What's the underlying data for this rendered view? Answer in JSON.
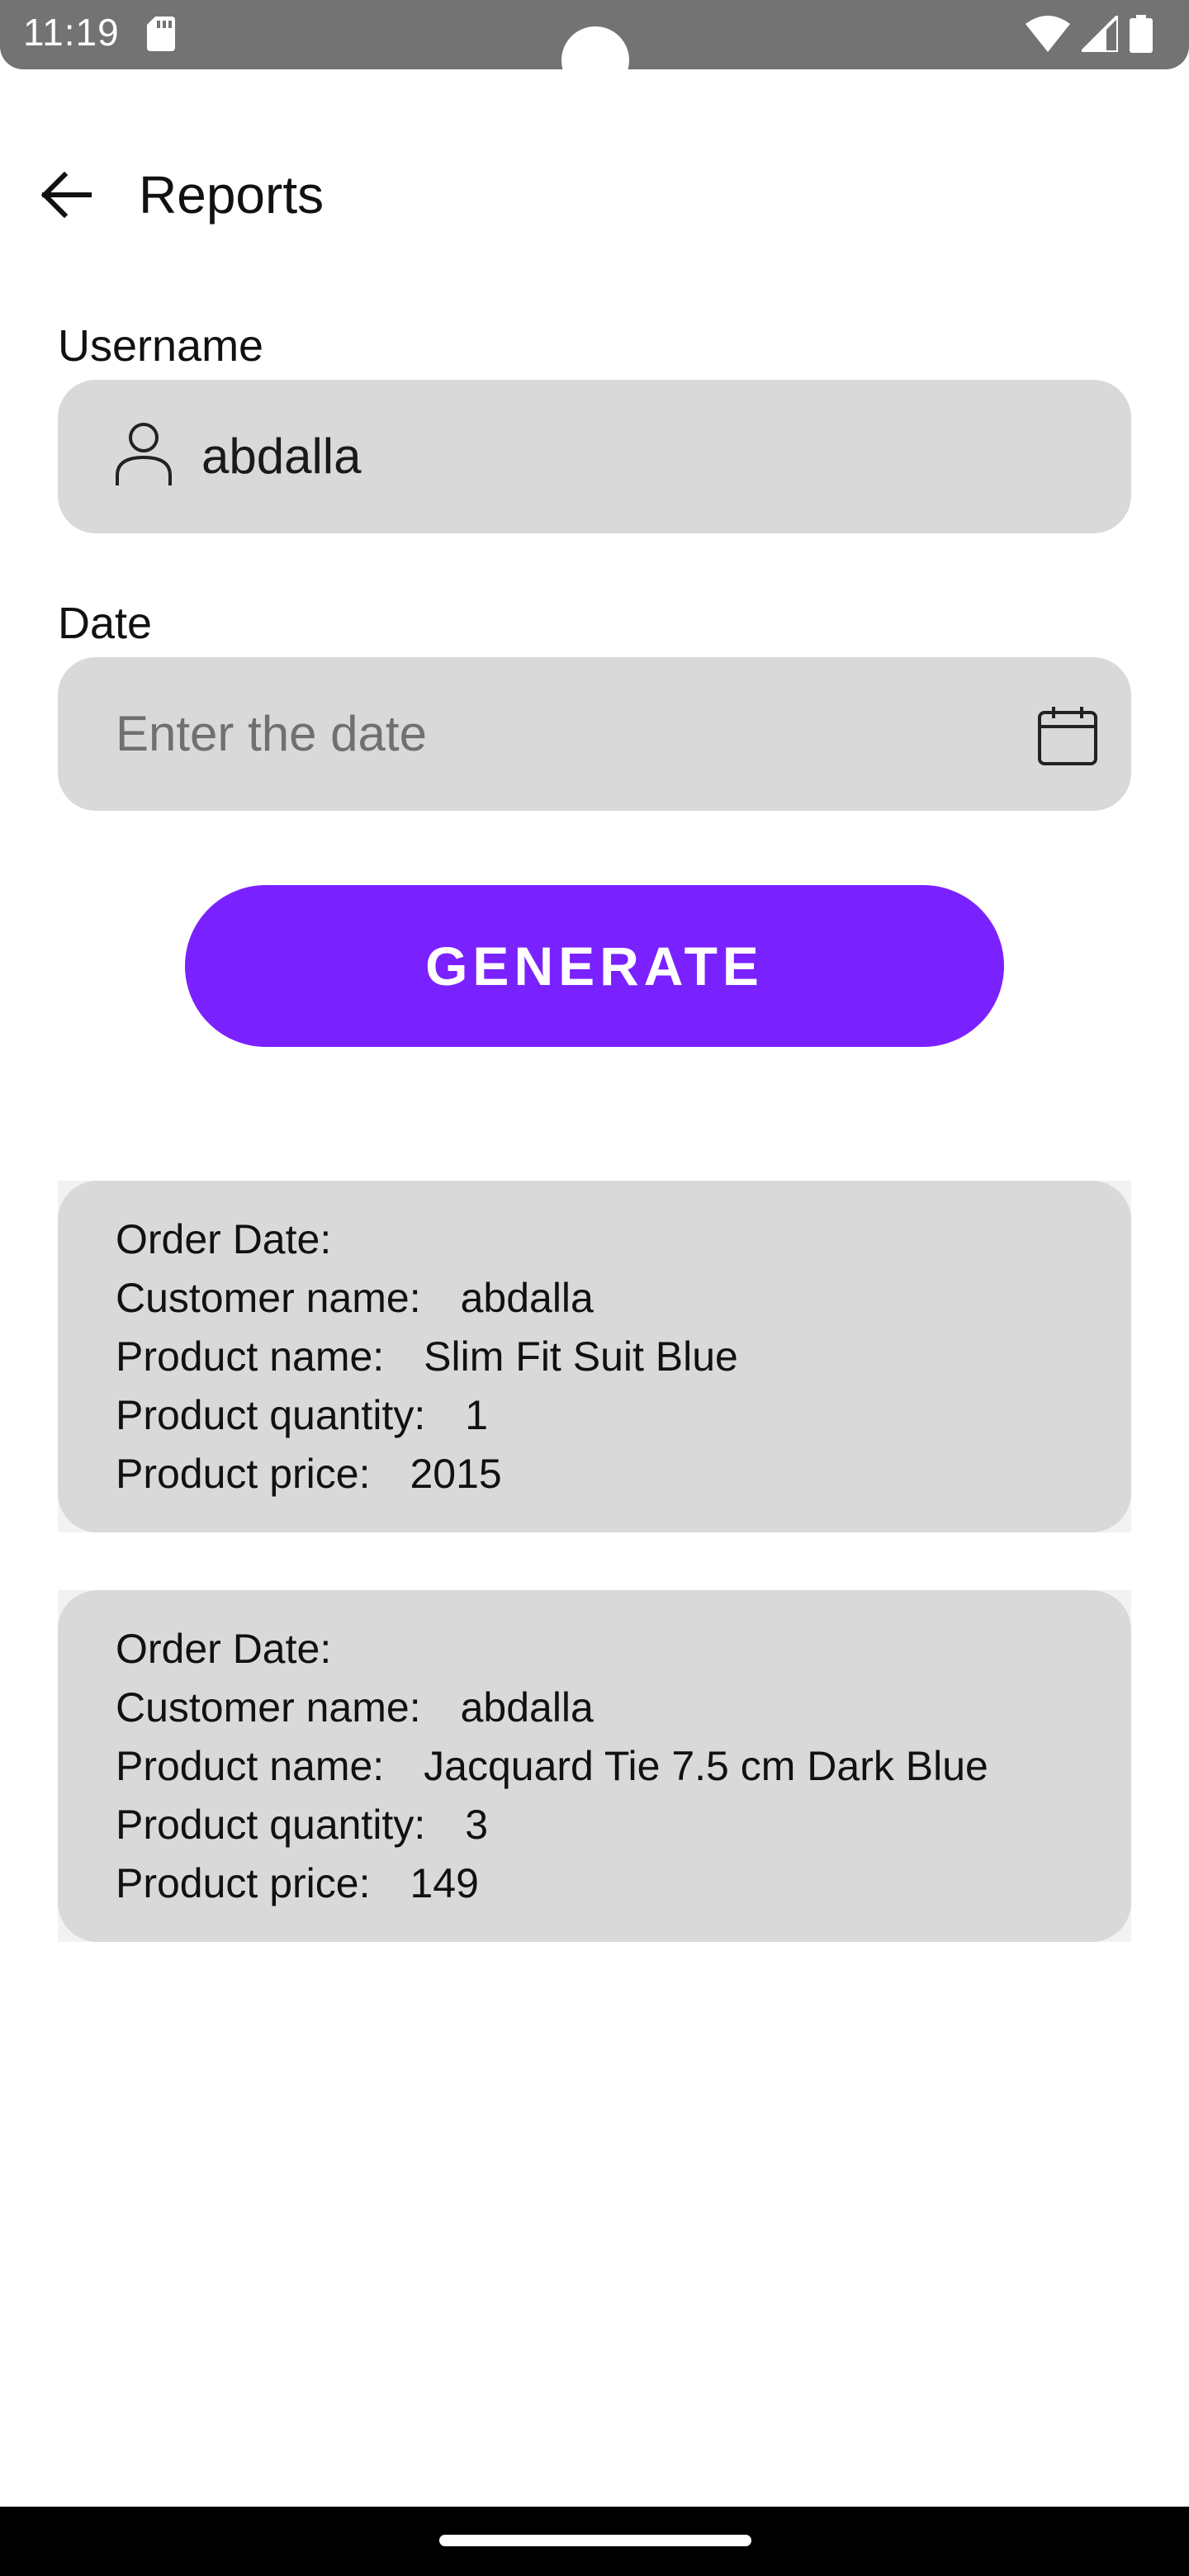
{
  "status_bar": {
    "time": "11:19",
    "icons": [
      "sd-card-icon",
      "wifi-icon",
      "signal-icon",
      "battery-icon"
    ]
  },
  "app_bar": {
    "back_icon": "arrow-back-icon",
    "title": "Reports"
  },
  "form": {
    "username": {
      "label": "Username",
      "value": "abdalla",
      "icon": "person-icon"
    },
    "date": {
      "label": "Date",
      "value": "",
      "placeholder": "Enter the date",
      "icon": "calendar-icon"
    },
    "generate_label": "GENERATE"
  },
  "report_labels": {
    "order_date": "Order Date:",
    "customer_name": "Customer name:",
    "product_name": "Product name:",
    "product_quantity": "Product quantity:",
    "product_price": "Product price:"
  },
  "reports": [
    {
      "order_date": "",
      "customer_name": "abdalla",
      "product_name": "Slim Fit Suit Blue",
      "product_quantity": "1",
      "product_price": "2015"
    },
    {
      "order_date": "",
      "customer_name": "abdalla",
      "product_name": "Jacquard Tie 7.5 cm Dark Blue",
      "product_quantity": "3",
      "product_price": "149"
    }
  ],
  "colors": {
    "accent": "#7a21ff",
    "field_background": "#d9d9d9",
    "status_bar": "#737373",
    "placeholder": "#707070"
  }
}
